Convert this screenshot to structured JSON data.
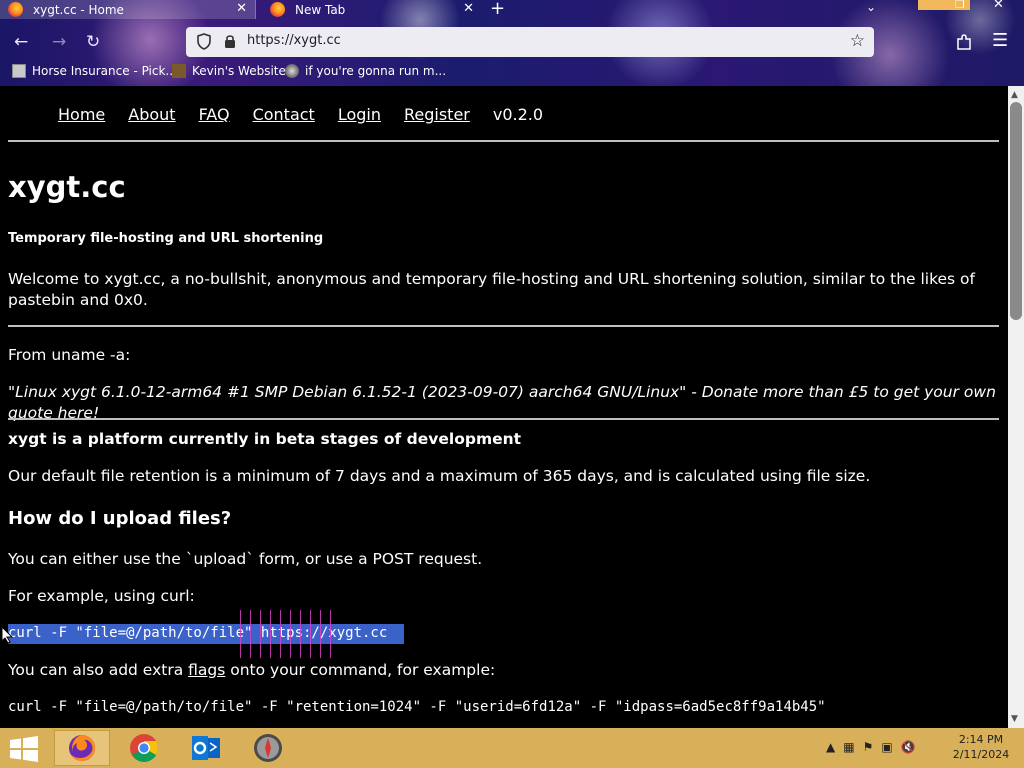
{
  "browser": {
    "tabs": [
      {
        "title": "xygt.cc - Home",
        "active": true
      },
      {
        "title": "New Tab",
        "active": false
      }
    ],
    "new_tab_glyph": "+",
    "url": "https://xygt.cc",
    "bookmarks": [
      {
        "label": "Horse Insurance - Pick..."
      },
      {
        "label": "Kevin's Website"
      },
      {
        "label": "if you're gonna run m..."
      }
    ]
  },
  "site": {
    "nav": [
      "Home",
      "About",
      "FAQ",
      "Contact",
      "Login",
      "Register"
    ],
    "version": "v0.2.0",
    "title": "xygt.cc",
    "subtitle": "Temporary file-hosting and URL shortening",
    "welcome": "Welcome to xygt.cc, a no-bullshit, anonymous and temporary file-hosting and URL shortening solution, similar to the likes of pastebin and 0x0.",
    "uname_label": "From uname -a:",
    "uname_quote": "\"Linux xygt 6.1.0-12-arm64 #1 SMP Debian 6.1.52-1 (2023-09-07) aarch64 GNU/Linux\" - Donate more than £5 to get your own quote here!",
    "beta_notice": "xygt is a platform currently in beta stages of development",
    "retention": "Our default file retention is a minimum of 7 days and a maximum of 365 days, and is calculated using file size.",
    "upload_heading": "How do I upload files?",
    "upload_text": "You can either use the `upload` form, or use a POST request.",
    "example_label": "For example, using curl:",
    "curl_basic": "curl -F \"file=@/path/to/file\" https://xygt.cc",
    "flags_before": "You can also add extra ",
    "flags_link": "flags",
    "flags_after": " onto your command, for example:",
    "curl_flags": "curl -F \"file=@/path/to/file\" -F \"retention=1024\" -F \"userid=6fd12a\" -F \"idpass=6ad5ec8ff9a14b45\""
  },
  "taskbar": {
    "time": "2:14 PM",
    "date": "2/11/2024",
    "apps": [
      "firefox",
      "chrome",
      "outlook",
      "other"
    ]
  },
  "colors": {
    "selection": "#3b62c9",
    "taskbar": "#d9b05a",
    "page_bg": "#000000"
  }
}
